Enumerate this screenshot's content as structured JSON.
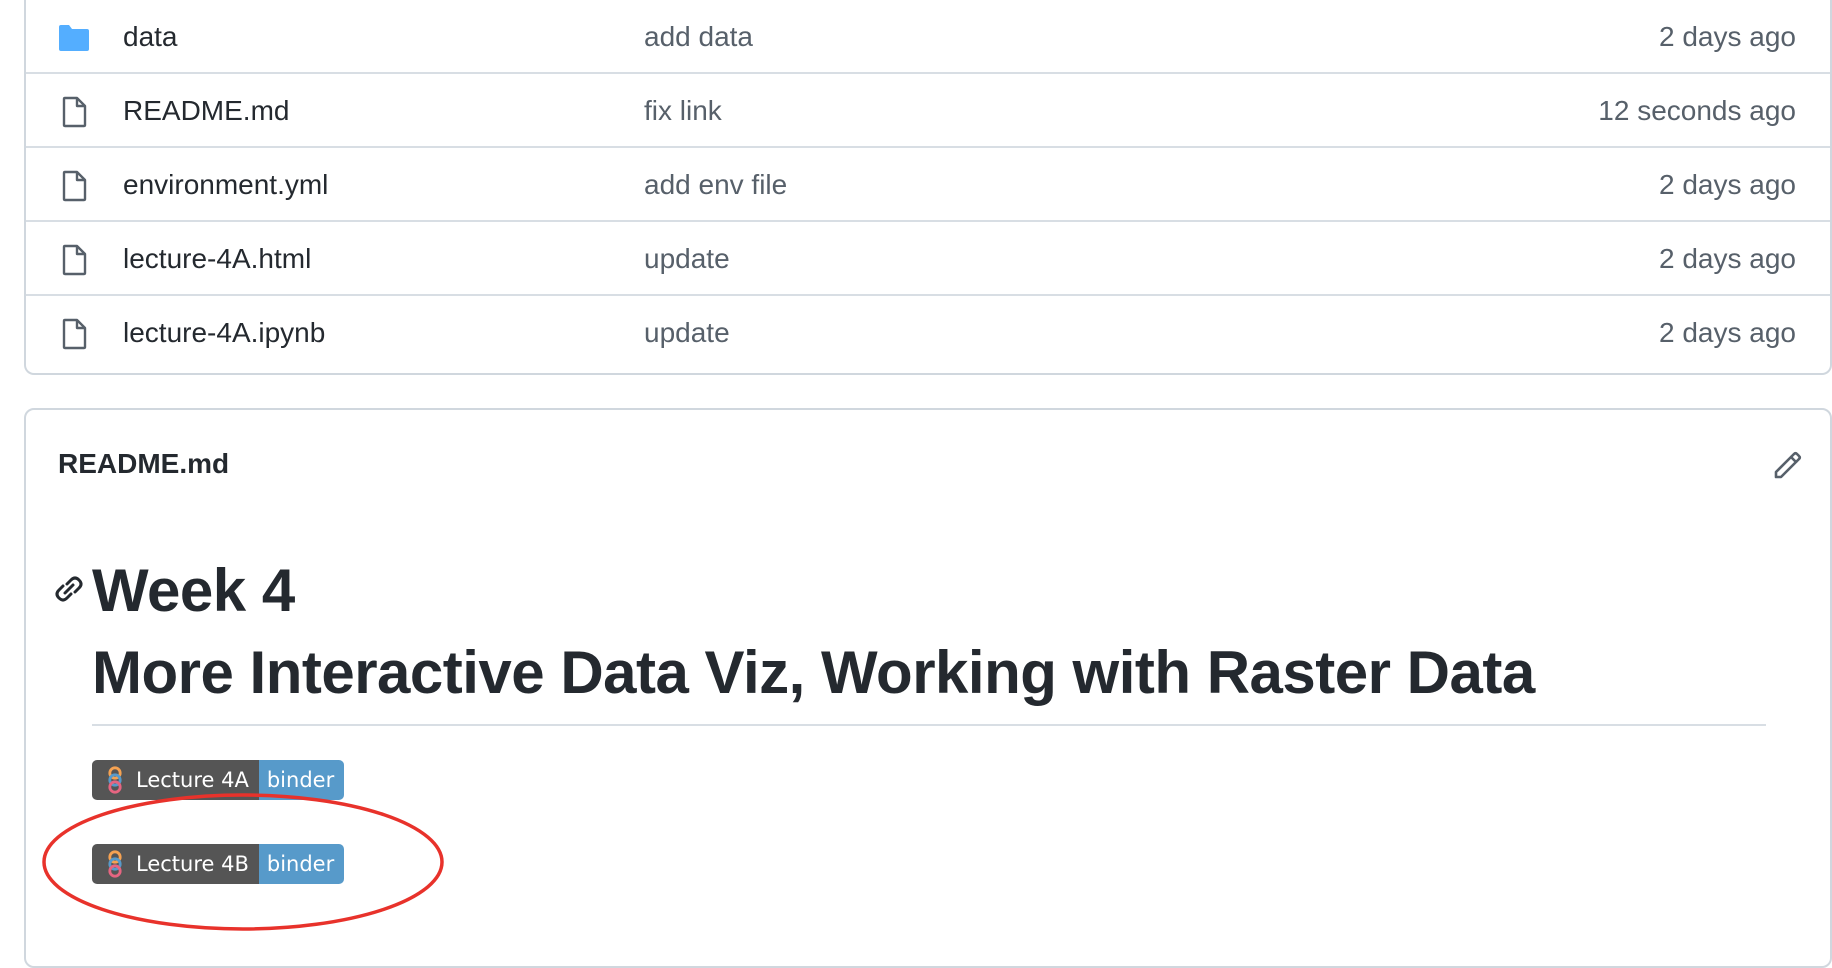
{
  "files": [
    {
      "name": "data",
      "message": "add data",
      "date": "2 days ago",
      "icon": "folder-icon"
    },
    {
      "name": "README.md",
      "message": "fix link",
      "date": "12 seconds ago",
      "icon": "file-icon"
    },
    {
      "name": "environment.yml",
      "message": "add env file",
      "date": "2 days ago",
      "icon": "file-icon"
    },
    {
      "name": "lecture-4A.html",
      "message": "update",
      "date": "2 days ago",
      "icon": "file-icon"
    },
    {
      "name": "lecture-4A.ipynb",
      "message": "update",
      "date": "2 days ago",
      "icon": "file-icon"
    }
  ],
  "readme": {
    "header": "README.md",
    "title_line1": "Week 4",
    "title_line2": "More Interactive Data Viz, Working with Raster Data",
    "badges": [
      {
        "label": "Lecture 4A",
        "tag": "binder"
      },
      {
        "label": "Lecture 4B",
        "tag": "binder"
      }
    ]
  },
  "colors": {
    "folder": "#54aeff",
    "badge_left": "#555555",
    "badge_right": "#579aca",
    "highlight": "#e8322b",
    "border": "#d0d7de"
  },
  "icons": {
    "edit": "pencil-icon",
    "anchor": "link-icon",
    "badge_logo": "binder-logo-icon"
  }
}
